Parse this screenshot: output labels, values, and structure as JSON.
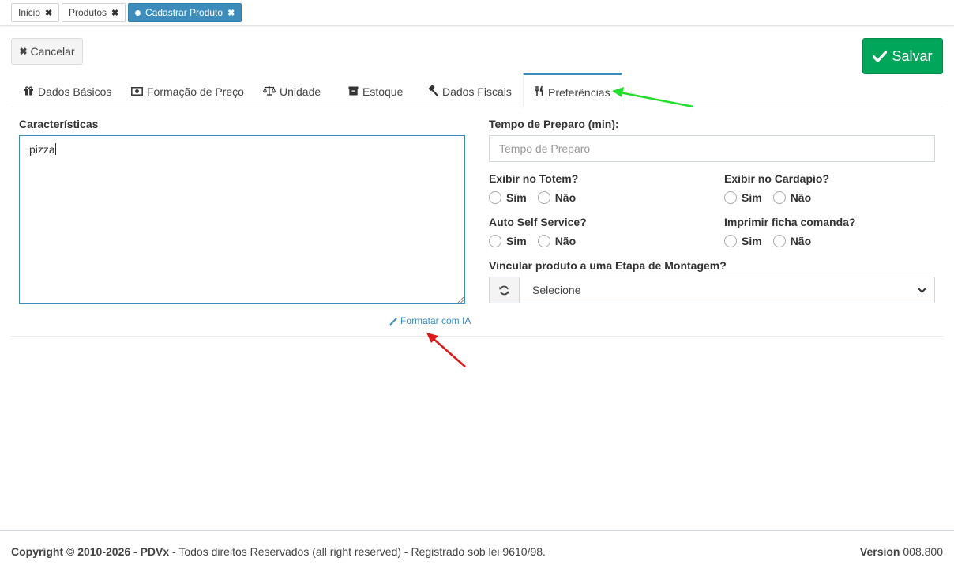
{
  "top_tabs": [
    {
      "label": "Inicio",
      "active": false
    },
    {
      "label": "Produtos",
      "active": false
    },
    {
      "label": "Cadastrar Produto",
      "active": true
    }
  ],
  "actions": {
    "cancel_label": "Cancelar",
    "save_label": "Salvar"
  },
  "content_tabs": [
    {
      "label": "Dados Básicos",
      "icon": "gift-icon"
    },
    {
      "label": "Formação de Preço",
      "icon": "money-icon"
    },
    {
      "label": "Unidade",
      "icon": "balance-scale-icon"
    },
    {
      "label": "Estoque",
      "icon": "archive-icon"
    },
    {
      "label": "Dados Fiscais",
      "icon": "gavel-icon"
    },
    {
      "label": "Preferências",
      "icon": "cutlery-icon",
      "active": true
    }
  ],
  "form": {
    "caracteristicas": {
      "label": "Características",
      "value": "pizza"
    },
    "ai_format_label": "Formatar com IA",
    "tempo_preparo": {
      "label": "Tempo de Preparo (min):",
      "placeholder": "Tempo de Preparo"
    },
    "exibir_totem": {
      "label": "Exibir no Totem?",
      "yes": "Sim",
      "no": "Não"
    },
    "exibir_cardapio": {
      "label": "Exibir no Cardapio?",
      "yes": "Sim",
      "no": "Não"
    },
    "auto_self_service": {
      "label": "Auto Self Service?",
      "yes": "Sim",
      "no": "Não"
    },
    "imprimir_ficha": {
      "label": "Imprimir ficha comanda?",
      "yes": "Sim",
      "no": "Não"
    },
    "etapa_montagem": {
      "label": "Vincular produto a uma Etapa de Montagem?",
      "selected": "Selecione"
    }
  },
  "footer": {
    "copyright_bold": "Copyright © 2010-2026 - PDVx",
    "copyright_rest": " - Todos direitos Reservados (all right reserved) - Registrado sob lei 9610/98.",
    "version_label": "Version",
    "version_value": " 008.800"
  },
  "colors": {
    "primary": "#3c8dbc",
    "success": "#00a65a",
    "arrow_green": "#22e02a",
    "arrow_red": "#e01818"
  }
}
